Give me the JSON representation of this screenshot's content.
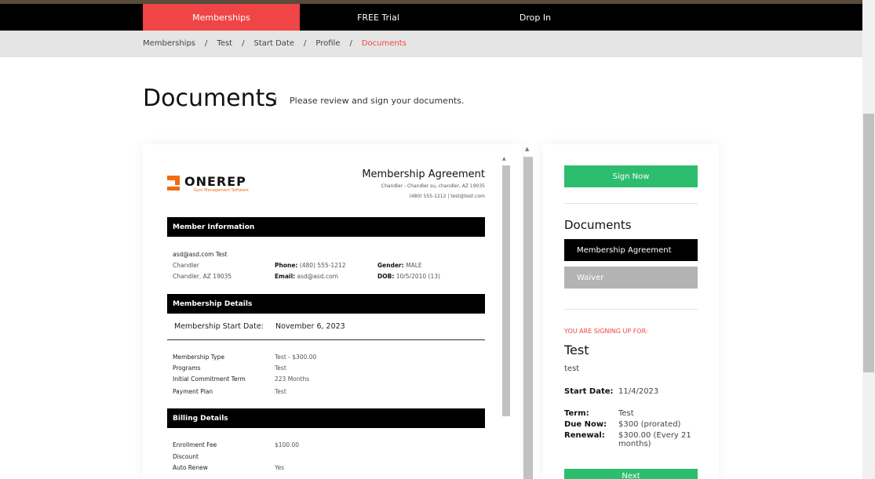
{
  "nav": {
    "tabs": [
      {
        "label": "Memberships",
        "active": true
      },
      {
        "label": "FREE Trial",
        "active": false
      },
      {
        "label": "Drop In",
        "active": false
      }
    ]
  },
  "breadcrumb": {
    "items": [
      "Memberships",
      "Test",
      "Start Date",
      "Profile",
      "Documents"
    ],
    "separator": "/"
  },
  "header": {
    "title": "Documents",
    "subtitle": "Please review and sign your documents."
  },
  "document": {
    "logo_name": "ONEREP",
    "logo_tagline": "Gym Management Software",
    "title": "Membership Agreement",
    "address": "Chandler - Chandler su, chandler, AZ 19035",
    "contact": "(480) 555-1212 | test@test.com",
    "member_info": {
      "heading": "Member Information",
      "name_line": "asd@asd.com Test",
      "city": "Chandler",
      "city_state_zip": "Chandler, AZ 19035",
      "phone_label": "Phone:",
      "phone": "(480) 555-1212",
      "email_label": "Email:",
      "email": "asd@asd.com",
      "gender_label": "Gender:",
      "gender": "MALE",
      "dob_label": "DOB:",
      "dob": "10/5/2010 (13)"
    },
    "membership_details": {
      "heading": "Membership Details",
      "start_label": "Membership Start Date:",
      "start_value": "November 6, 2023",
      "rows": [
        {
          "label": "Membership Type",
          "value": "Test - $300.00"
        },
        {
          "label": "Programs",
          "value": "Test"
        },
        {
          "label": "Initial Commitment Term",
          "value": "223 Months"
        },
        {
          "label": "Payment Plan",
          "value": "Test"
        }
      ]
    },
    "billing_details": {
      "heading": "Billing Details",
      "rows": [
        {
          "label": "Enrollment Fee",
          "value": "$100.00"
        },
        {
          "label": "Discount",
          "value": ""
        },
        {
          "label": "Auto Renew",
          "value": "Yes"
        }
      ]
    }
  },
  "sidebar": {
    "sign_now_label": "Sign Now",
    "documents_heading": "Documents",
    "documents": [
      {
        "label": "Membership Agreement",
        "active": true
      },
      {
        "label": "Waiver",
        "active": false
      }
    ],
    "signing_for_label": "YOU ARE SIGNING UP FOR:",
    "plan_name": "Test",
    "plan_sub": "test",
    "start_date_label": "Start Date:",
    "start_date": "11/4/2023",
    "term_label": "Term:",
    "term": "Test",
    "due_now_label": "Due Now:",
    "due_now": "$300 (prorated)",
    "renewal_label": "Renewal:",
    "renewal": "$300.00 (Every 21 months)",
    "next_label": "Next"
  },
  "colors": {
    "accent": "#ef4546",
    "green": "#2dbd6e",
    "logo_orange": "#f26b0f"
  }
}
